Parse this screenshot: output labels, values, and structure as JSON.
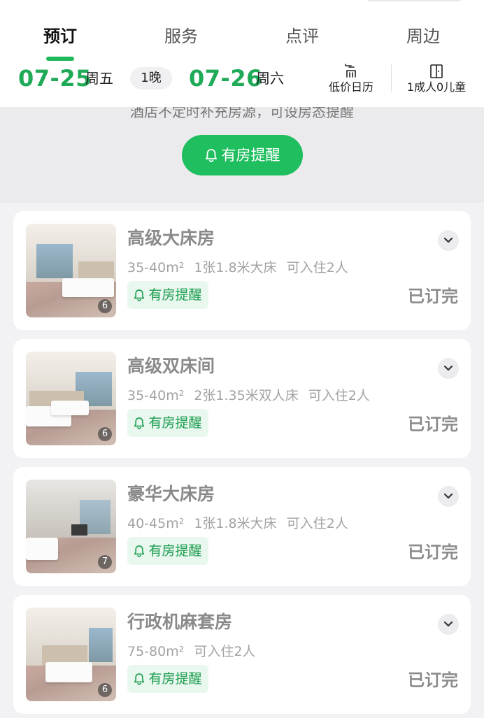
{
  "tabs": [
    {
      "label": "预订"
    },
    {
      "label": "服务"
    },
    {
      "label": "点评"
    },
    {
      "label": "周边"
    }
  ],
  "dates": {
    "checkin": {
      "date": "07-25",
      "weekday": "周五"
    },
    "nights": "1晚",
    "checkout": {
      "date": "07-26",
      "weekday": "周六"
    }
  },
  "tools": {
    "calendar_label": "低价日历",
    "guests_label": "1成人0儿童"
  },
  "notice": {
    "text": "酒店不定时补充房源，可设房态提醒",
    "button_label": "有房提醒"
  },
  "rooms": [
    {
      "name": "高级大床房",
      "area": "35-40m²",
      "bed": "1张1.8米大床",
      "occupancy": "可入住2人",
      "alert": "有房提醒",
      "status": "已订完",
      "photos": "6"
    },
    {
      "name": "高级双床间",
      "area": "35-40m²",
      "bed": "2张1.35米双人床",
      "occupancy": "可入住2人",
      "alert": "有房提醒",
      "status": "已订完",
      "photos": "6"
    },
    {
      "name": "豪华大床房",
      "area": "40-45m²",
      "bed": "1张1.8米大床",
      "occupancy": "可入住2人",
      "alert": "有房提醒",
      "status": "已订完",
      "photos": "7"
    },
    {
      "name": "行政机麻套房",
      "area": "75-80m²",
      "bed": "",
      "occupancy": "可入住2人",
      "alert": "有房提醒",
      "status": "已订完",
      "photos": "6"
    }
  ],
  "colors": {
    "accent": "#1fbe5e",
    "date_green": "#1eaa57",
    "alert_bg": "#e9f8ee"
  },
  "icons": [
    "bell-icon",
    "calendar-icon",
    "door-icon",
    "chevron-down-icon"
  ]
}
